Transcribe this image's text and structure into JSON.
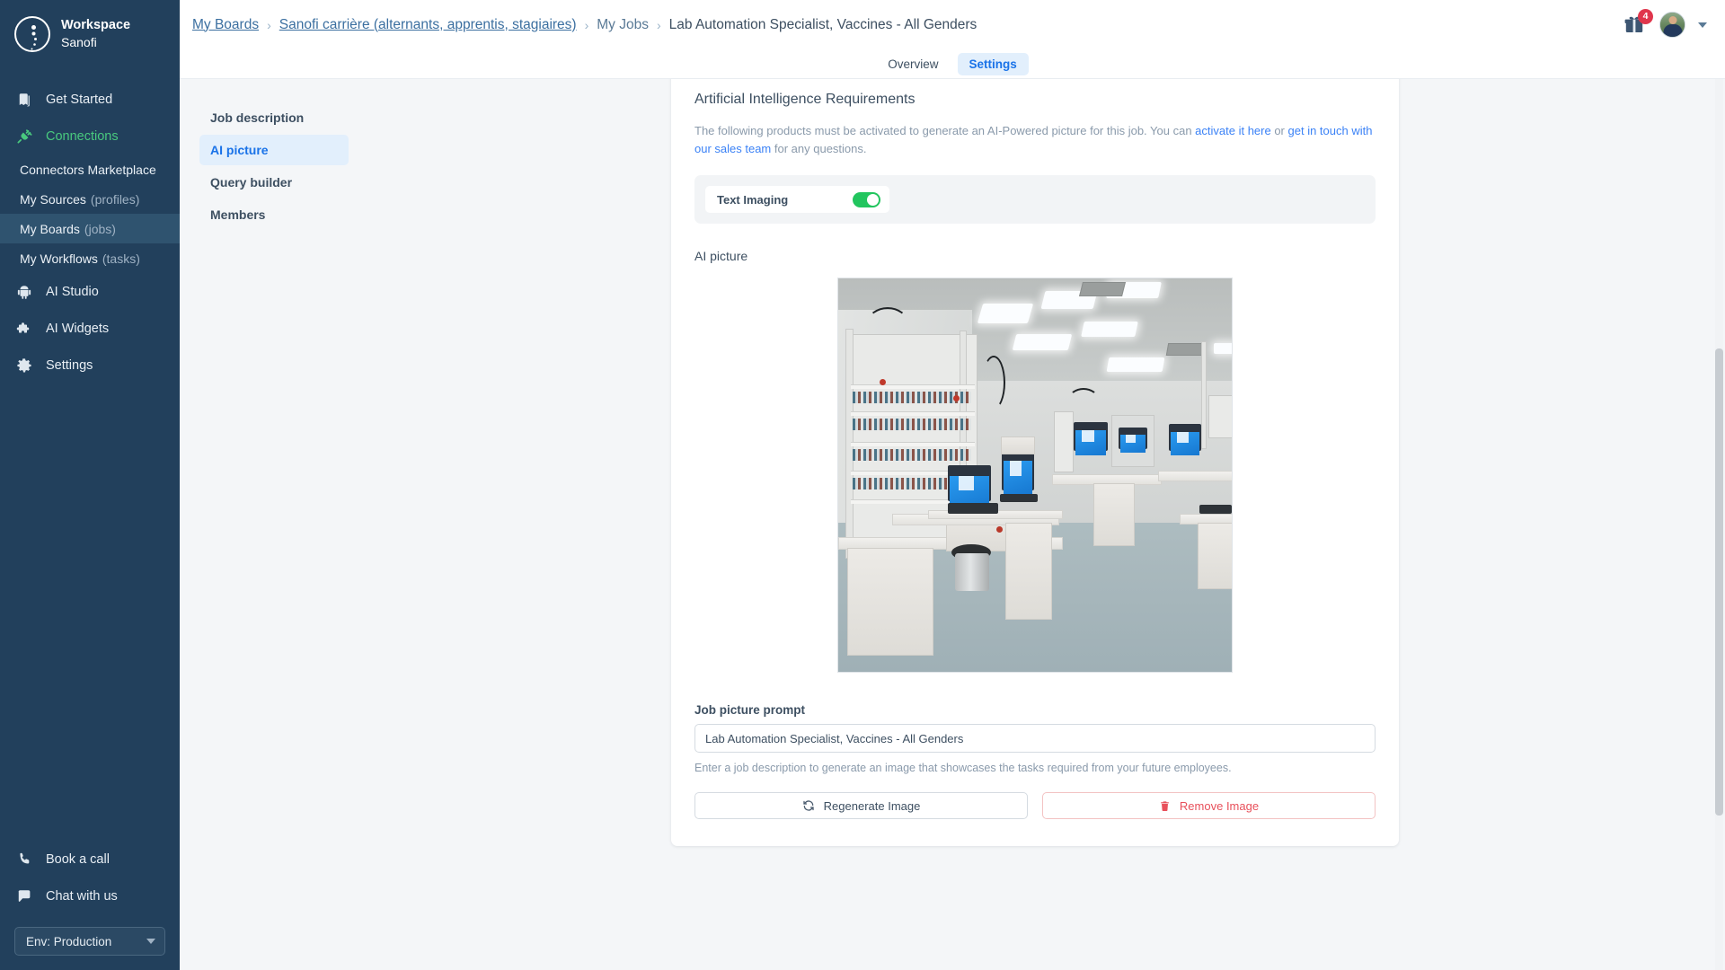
{
  "sidebar": {
    "workspace_label": "Workspace",
    "workspace_name": "Sanofi",
    "items": [
      {
        "label": "Get Started",
        "icon": "book-icon"
      },
      {
        "label": "Connections",
        "icon": "plug-icon"
      }
    ],
    "connections_sub": [
      {
        "label": "Connectors Marketplace",
        "suffix": ""
      },
      {
        "label": "My Sources",
        "suffix": "(profiles)"
      },
      {
        "label": "My Boards",
        "suffix": "(jobs)"
      },
      {
        "label": "My Workflows",
        "suffix": "(tasks)"
      }
    ],
    "items_lower": [
      {
        "label": "AI Studio",
        "icon": "android-icon"
      },
      {
        "label": "AI Widgets",
        "icon": "puzzle-icon"
      },
      {
        "label": "Settings",
        "icon": "gear-icon"
      }
    ],
    "support": [
      {
        "label": "Book a call",
        "icon": "phone-icon"
      },
      {
        "label": "Chat with us",
        "icon": "chat-icon"
      }
    ],
    "env_selector": "Env: Production"
  },
  "topbar": {
    "breadcrumb": [
      {
        "label": "My Boards",
        "type": "link"
      },
      {
        "label": "Sanofi carrière (alternants, apprentis, stagiaires)",
        "type": "link"
      },
      {
        "label": "My Jobs",
        "type": "text"
      },
      {
        "label": "Lab Automation Specialist, Vaccines - All Genders",
        "type": "current"
      }
    ],
    "separator": "›",
    "gift_badge_count": "4"
  },
  "tabs": [
    {
      "label": "Overview",
      "active": false
    },
    {
      "label": "Settings",
      "active": true
    }
  ],
  "leftnav": [
    {
      "label": "Job description",
      "active": false
    },
    {
      "label": "AI picture",
      "active": true
    },
    {
      "label": "Query builder",
      "active": false
    },
    {
      "label": "Members",
      "active": false
    }
  ],
  "panel": {
    "heading": "Artificial Intelligence Requirements",
    "intro_part1": "The following products must be activated to generate an AI-Powered picture for this job. You can ",
    "intro_link1": "activate it here",
    "intro_part2": " or ",
    "intro_link2": "get in touch with our sales team",
    "intro_part3": " for any questions.",
    "product": {
      "label": "Text Imaging",
      "enabled": true
    },
    "picture_section_title": "AI picture",
    "picture_alt": "laboratory-automation-workstation-photo",
    "prompt_label": "Job picture prompt",
    "prompt_value": "Lab Automation Specialist, Vaccines - All Genders",
    "prompt_placeholder": "Enter a job description",
    "hint": "Enter a job description to generate an image that showcases the tasks required from your future employees.",
    "regenerate_button": "Regenerate Image",
    "remove_button": "Remove Image"
  },
  "colors": {
    "sidebar_bg": "#22405c",
    "accent_blue": "#1a73e8",
    "link_blue": "#3b82f6",
    "toggle_green": "#22c55e",
    "danger_red": "#e8505b",
    "badge_red": "#e0364c"
  }
}
